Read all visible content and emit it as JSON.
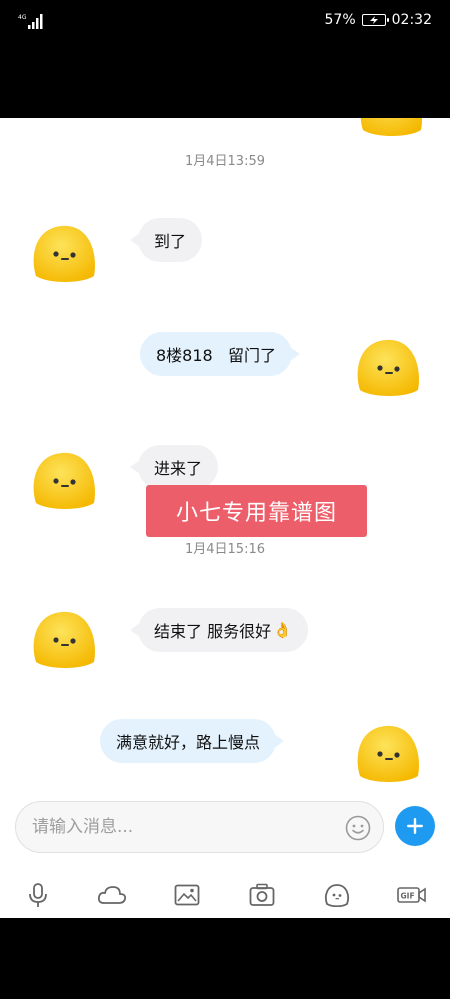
{
  "status_bar": {
    "network": "4G",
    "battery": "57%",
    "time": "02:32"
  },
  "messages": [
    {
      "type": "timestamp",
      "text": "1月4日13:59"
    },
    {
      "type": "in",
      "text": "到了"
    },
    {
      "type": "out",
      "text": "8楼818   留门了"
    },
    {
      "type": "in",
      "text": "进来了"
    },
    {
      "type": "timestamp",
      "text": "1月4日15:16"
    },
    {
      "type": "in",
      "text": "结束了 服务很好"
    },
    {
      "type": "out",
      "text": "满意就好，路上慢点"
    }
  ],
  "watermark": {
    "text": "小七专用靠谱图"
  },
  "input": {
    "placeholder": "请输入消息..."
  },
  "toolbar": {
    "icons": [
      "microphone-icon",
      "cloud-icon",
      "image-icon",
      "camera-icon",
      "emoji-ghost-icon",
      "gif-icon"
    ],
    "gif_label": "GIF"
  },
  "colors": {
    "accent": "#1e9bf0",
    "incoming_bubble": "#f1f1f3",
    "outgoing_bubble": "#e3f2fd",
    "watermark": "#ec5f6a",
    "avatar": "#f9c61a"
  }
}
